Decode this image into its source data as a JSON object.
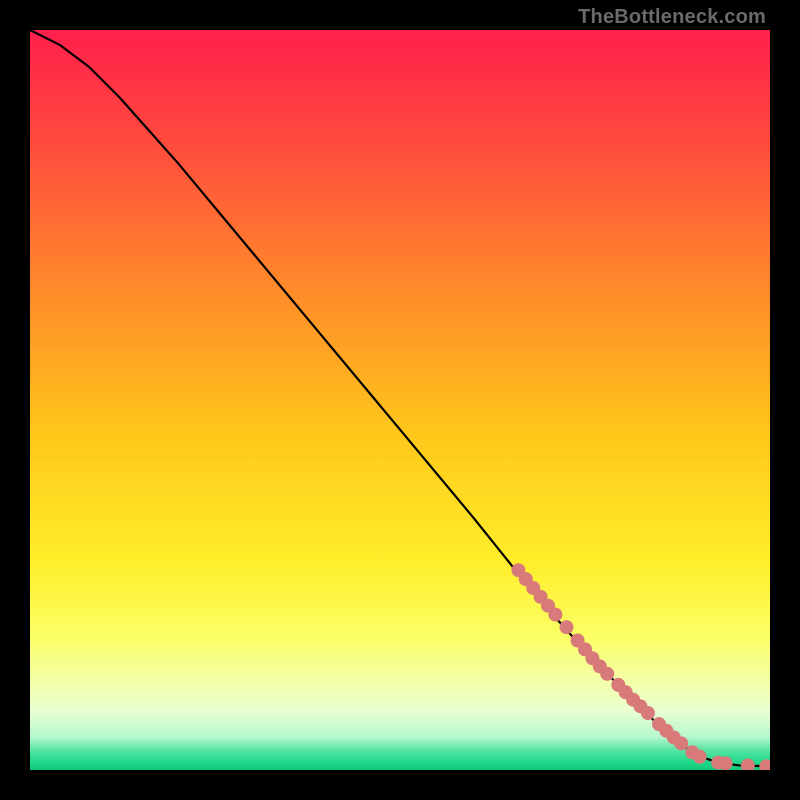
{
  "watermark": "TheBottleneck.com",
  "colors": {
    "background_black": "#000000",
    "line": "#000000",
    "marker": "#d87a7a",
    "gradient_stops": [
      {
        "offset": 0.0,
        "color": "#ff1f4c"
      },
      {
        "offset": 0.15,
        "color": "#ff4a3e"
      },
      {
        "offset": 0.35,
        "color": "#ff8a2a"
      },
      {
        "offset": 0.55,
        "color": "#ffc81a"
      },
      {
        "offset": 0.72,
        "color": "#ffee2a"
      },
      {
        "offset": 0.82,
        "color": "#fbff66"
      },
      {
        "offset": 0.88,
        "color": "#f4ffa8"
      },
      {
        "offset": 0.92,
        "color": "#e9ffd0"
      },
      {
        "offset": 0.955,
        "color": "#b7f7cf"
      },
      {
        "offset": 0.975,
        "color": "#4fe3a0"
      },
      {
        "offset": 0.99,
        "color": "#1fd88a"
      },
      {
        "offset": 1.0,
        "color": "#12c77a"
      }
    ]
  },
  "chart_data": {
    "type": "line",
    "title": "",
    "xlabel": "",
    "ylabel": "",
    "xlim": [
      0,
      100
    ],
    "ylim": [
      0,
      100
    ],
    "note": "Axes are unlabeled; values estimated from pixel positions with 0–100 normalized scale. Y increases upward.",
    "series": [
      {
        "name": "curve",
        "style": "solid-black-line",
        "points": [
          {
            "x": 0,
            "y": 100
          },
          {
            "x": 4,
            "y": 98
          },
          {
            "x": 8,
            "y": 95
          },
          {
            "x": 12,
            "y": 91
          },
          {
            "x": 16,
            "y": 86.5
          },
          {
            "x": 20,
            "y": 82
          },
          {
            "x": 30,
            "y": 70
          },
          {
            "x": 40,
            "y": 58
          },
          {
            "x": 50,
            "y": 46
          },
          {
            "x": 60,
            "y": 34
          },
          {
            "x": 68,
            "y": 24
          },
          {
            "x": 76,
            "y": 15
          },
          {
            "x": 82,
            "y": 9
          },
          {
            "x": 86,
            "y": 5
          },
          {
            "x": 90,
            "y": 2
          },
          {
            "x": 93,
            "y": 1
          },
          {
            "x": 96,
            "y": 0.6
          },
          {
            "x": 100,
            "y": 0.5
          }
        ]
      }
    ],
    "markers_on_curve": {
      "name": "highlighted-segments",
      "style": "thick-salmon-dots",
      "points": [
        {
          "x": 66,
          "y": 27
        },
        {
          "x": 67,
          "y": 25.8
        },
        {
          "x": 68,
          "y": 24.6
        },
        {
          "x": 69,
          "y": 23.4
        },
        {
          "x": 70,
          "y": 22.2
        },
        {
          "x": 71,
          "y": 21.0
        },
        {
          "x": 72.5,
          "y": 19.3
        },
        {
          "x": 74,
          "y": 17.5
        },
        {
          "x": 75,
          "y": 16.3
        },
        {
          "x": 76,
          "y": 15.1
        },
        {
          "x": 77,
          "y": 14.0
        },
        {
          "x": 78,
          "y": 13.0
        },
        {
          "x": 79.5,
          "y": 11.5
        },
        {
          "x": 80.5,
          "y": 10.5
        },
        {
          "x": 81.5,
          "y": 9.5
        },
        {
          "x": 82.5,
          "y": 8.6
        },
        {
          "x": 83.5,
          "y": 7.7
        },
        {
          "x": 85,
          "y": 6.2
        },
        {
          "x": 86,
          "y": 5.3
        },
        {
          "x": 87,
          "y": 4.4
        },
        {
          "x": 88,
          "y": 3.6
        },
        {
          "x": 89.5,
          "y": 2.4
        },
        {
          "x": 90.5,
          "y": 1.8
        },
        {
          "x": 93,
          "y": 1.0
        },
        {
          "x": 94,
          "y": 0.9
        },
        {
          "x": 97,
          "y": 0.6
        },
        {
          "x": 99.5,
          "y": 0.5
        }
      ]
    }
  }
}
